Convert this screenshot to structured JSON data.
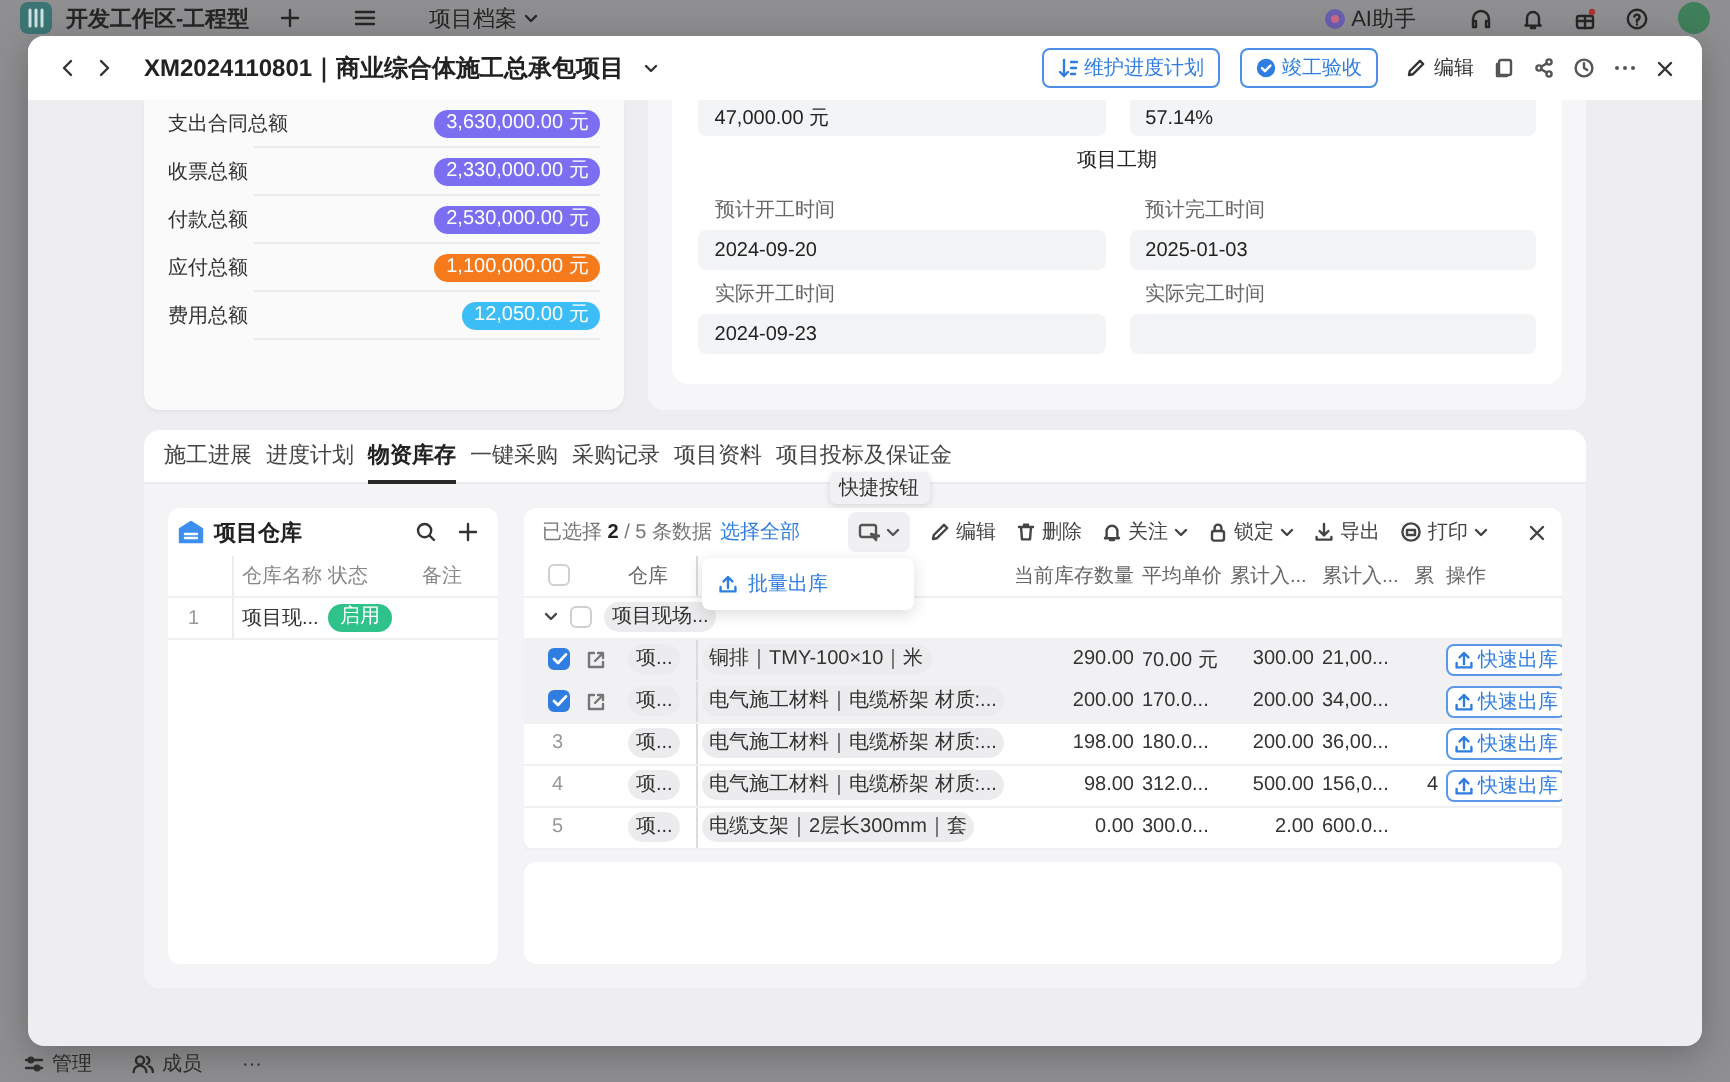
{
  "background_app": {
    "workspace": "开发工作区-工程型",
    "tab": "项目档案",
    "assistant": "AI助手",
    "bottom_items": [
      {
        "label": "管理",
        "kind": "manage"
      },
      {
        "label": "成员",
        "kind": "members"
      },
      {
        "label": "···",
        "kind": "more"
      }
    ]
  },
  "header": {
    "title": "XM2024110801｜商业综合体施工总承包项目",
    "actions": [
      {
        "label": "维护进度计划",
        "kind": "schedule"
      },
      {
        "label": "竣工验收",
        "kind": "accept"
      }
    ],
    "edit": "编辑"
  },
  "finance": [
    {
      "label": "支出合同总额",
      "value": "3,630,000.00 元",
      "color": "#7b6ef0"
    },
    {
      "label": "收票总额",
      "value": "2,330,000.00 元",
      "color": "#7b6ef0"
    },
    {
      "label": "付款总额",
      "value": "2,530,000.00 元",
      "color": "#7b6ef0"
    },
    {
      "label": "应付总额",
      "value": "1,100,000.00 元",
      "color": "#f57a1c"
    },
    {
      "label": "费用总额",
      "value": "12,050.00 元",
      "color": "#3dbdf6"
    }
  ],
  "schedule": {
    "values": [
      "47,000.00 元",
      "57.14%"
    ],
    "section_title": "项目工期",
    "fields": [
      {
        "label": "预计开工时间",
        "value": "2024-09-20"
      },
      {
        "label": "预计完工时间",
        "value": "2025-01-03"
      },
      {
        "label": "实际开工时间",
        "value": "2024-09-23"
      },
      {
        "label": "实际完工时间"
      }
    ]
  },
  "tabs": [
    {
      "label": "施工进展",
      "selected": false
    },
    {
      "label": "进度计划",
      "selected": false
    },
    {
      "label": "物资库存",
      "selected": true
    },
    {
      "label": "一键采购",
      "selected": false
    },
    {
      "label": "采购记录",
      "selected": false
    },
    {
      "label": "项目资料",
      "selected": false
    },
    {
      "label": "项目投标及保证金",
      "selected": false
    }
  ],
  "warehouse": {
    "title": "项目仓库",
    "columns": [
      "仓库名称",
      "状态",
      "备注"
    ],
    "rows": [
      {
        "number": "1",
        "name": "项目现...",
        "status": "启用"
      }
    ]
  },
  "stock": {
    "selection": "已选择 **2** / 5 条数据",
    "select_all": "选择全部",
    "tooltip": "快捷按钮",
    "menu": [
      "批量出库"
    ],
    "toolbar": [
      {
        "label": "编辑",
        "kind": "edit",
        "dropdown": false
      },
      {
        "label": "删除",
        "kind": "delete",
        "dropdown": false
      },
      {
        "label": "关注",
        "kind": "follow",
        "dropdown": true
      },
      {
        "label": "锁定",
        "kind": "lock",
        "dropdown": true
      },
      {
        "label": "导出",
        "kind": "export",
        "dropdown": false
      },
      {
        "label": "打印",
        "kind": "print",
        "dropdown": true
      }
    ],
    "all_selected": false,
    "columns": [
      "仓库",
      "当前库存数量",
      "平均单价",
      "累计入...",
      "累计入...",
      "累",
      "操作"
    ],
    "group": {
      "label": "项目现场...",
      "expanded": true,
      "checked": false
    },
    "rows": [
      {
        "selected": true,
        "warehouse": "项...",
        "material": "铜排｜TMY-100×10｜米",
        "stock_qty": "290.00",
        "avg_price": "70.00 元",
        "in_qty": "300.00",
        "in_amount": "21,00...",
        "action": "快速出库"
      },
      {
        "selected": true,
        "warehouse": "项...",
        "material": "电气施工材料｜电缆桥架 材质:...",
        "stock_qty": "200.00",
        "avg_price": "170.0...",
        "in_qty": "200.00",
        "in_amount": "34,00...",
        "action": "快速出库"
      },
      {
        "selected": false,
        "number": "3",
        "warehouse": "项...",
        "material": "电气施工材料｜电缆桥架 材质:...",
        "stock_qty": "198.00",
        "avg_price": "180.0...",
        "in_qty": "200.00",
        "in_amount": "36,00...",
        "action": "快速出库"
      },
      {
        "selected": false,
        "number": "4",
        "warehouse": "项...",
        "material": "电气施工材料｜电缆桥架 材质:...",
        "stock_qty": "98.00",
        "avg_price": "312.0...",
        "in_qty": "500.00",
        "in_amount": "156,0...",
        "column_9": "4",
        "action": "快速出库"
      },
      {
        "selected": false,
        "number": "5",
        "warehouse": "项...",
        "material": "电缆支架｜2层长300mm｜套",
        "stock_qty": "0.00",
        "avg_price": "300.0...",
        "in_qty": "2.00",
        "in_amount": "600.0..."
      }
    ]
  }
}
